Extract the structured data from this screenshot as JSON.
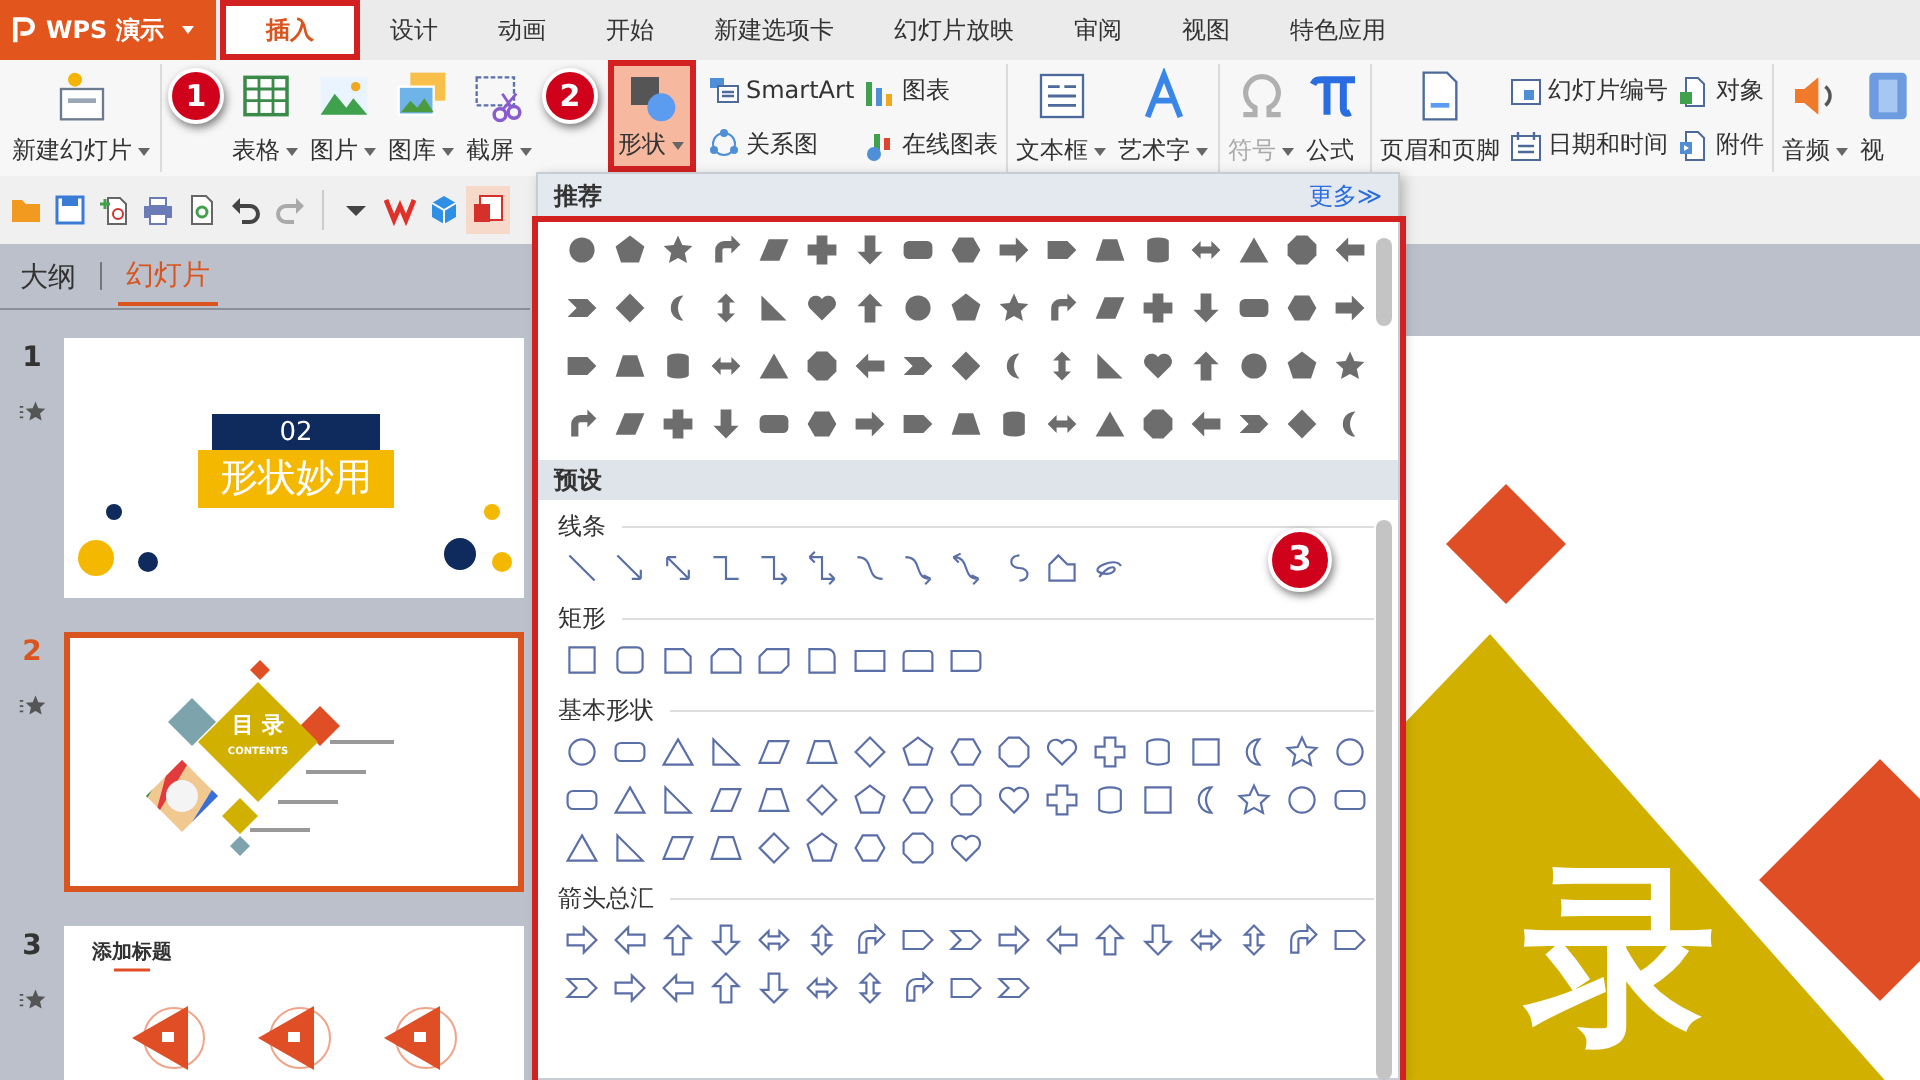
{
  "app": {
    "name": "WPS 演示"
  },
  "tabs": [
    {
      "label": "插入",
      "selected": true
    },
    {
      "label": "设计",
      "selected": false
    },
    {
      "label": "动画",
      "selected": false
    },
    {
      "label": "开始",
      "selected": false
    },
    {
      "label": "新建选项卡",
      "selected": false
    },
    {
      "label": "幻灯片放映",
      "selected": false
    },
    {
      "label": "审阅",
      "selected": false
    },
    {
      "label": "视图",
      "selected": false
    },
    {
      "label": "特色应用",
      "selected": false
    }
  ],
  "ribbon": {
    "groups": [
      {
        "items": [
          {
            "kind": "large",
            "label": "新建幻灯片",
            "dropdown": true,
            "pressed": false,
            "disabled": false
          }
        ]
      },
      {
        "items": [
          {
            "kind": "large",
            "label": "表格",
            "dropdown": true,
            "pressed": false,
            "disabled": false
          },
          {
            "kind": "large",
            "label": "图片",
            "dropdown": true,
            "pressed": false,
            "disabled": false
          },
          {
            "kind": "large",
            "label": "图库",
            "dropdown": true,
            "pressed": false,
            "disabled": false
          },
          {
            "kind": "large",
            "label": "截屏",
            "dropdown": true,
            "pressed": false,
            "disabled": false
          },
          {
            "kind": "large",
            "label": "形状",
            "dropdown": true,
            "pressed": true,
            "disabled": false
          },
          {
            "kind": "stack",
            "items": [
              {
                "label": "SmartArt"
              },
              {
                "label": "关系图"
              }
            ]
          },
          {
            "kind": "stack",
            "items": [
              {
                "label": "图表"
              },
              {
                "label": "在线图表"
              }
            ]
          }
        ]
      },
      {
        "items": [
          {
            "kind": "large",
            "label": "文本框",
            "dropdown": true,
            "pressed": false,
            "disabled": false
          },
          {
            "kind": "large",
            "label": "艺术字",
            "dropdown": true,
            "pressed": false,
            "disabled": false
          }
        ]
      },
      {
        "items": [
          {
            "kind": "large",
            "label": "符号",
            "dropdown": true,
            "pressed": false,
            "disabled": true
          },
          {
            "kind": "large",
            "label": "公式",
            "dropdown": false,
            "pressed": false,
            "disabled": false
          }
        ]
      },
      {
        "items": [
          {
            "kind": "large",
            "label": "页眉和页脚",
            "dropdown": false,
            "pressed": false,
            "disabled": false
          },
          {
            "kind": "stack",
            "items": [
              {
                "label": "幻灯片编号"
              },
              {
                "label": "日期和时间"
              }
            ]
          },
          {
            "kind": "stack",
            "items": [
              {
                "label": "对象"
              },
              {
                "label": "附件"
              }
            ]
          }
        ]
      },
      {
        "items": [
          {
            "kind": "large",
            "label": "音频",
            "dropdown": true,
            "pressed": false,
            "disabled": false
          },
          {
            "kind": "large",
            "label": "视",
            "dropdown": false,
            "pressed": false,
            "disabled": false
          }
        ]
      }
    ]
  },
  "slide_panel": {
    "tabs": [
      {
        "label": "大纲",
        "selected": false
      },
      {
        "label": "幻灯片",
        "selected": true
      }
    ],
    "slides": [
      {
        "number": "1",
        "kind": "title",
        "selected": false,
        "badge": "02",
        "title": "形状妙用"
      },
      {
        "number": "2",
        "kind": "contents",
        "selected": true,
        "title": "目 录",
        "subtitle": "CONTENTS"
      },
      {
        "number": "3",
        "kind": "icons",
        "selected": false,
        "title": "添加标题"
      }
    ]
  },
  "shape_menu": {
    "title": "推荐",
    "more": "更多≫",
    "preset_title": "预设",
    "sections": [
      {
        "title": "线条",
        "kind": "lines"
      },
      {
        "title": "矩形",
        "kind": "rects"
      },
      {
        "title": "基本形状",
        "kind": "basic"
      },
      {
        "title": "箭头总汇",
        "kind": "arrows"
      }
    ]
  },
  "editor": {
    "slide_text": "录"
  },
  "annotations": [
    {
      "number": "1"
    },
    {
      "number": "2"
    },
    {
      "number": "3"
    }
  ]
}
